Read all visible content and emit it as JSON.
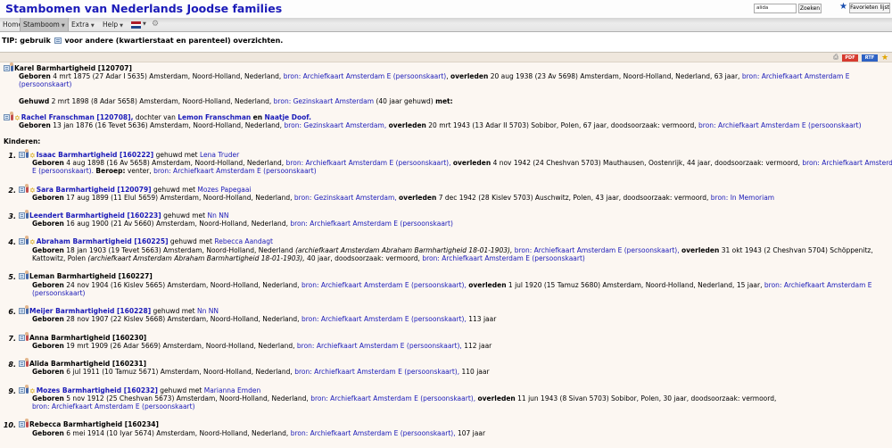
{
  "header": {
    "title": "Stambomen van Nederlands Joodse families",
    "search_value": "alida barmhartig",
    "search_button": "Zoeken",
    "favorites_button": "Favorieten lijst"
  },
  "menu": {
    "home": "Home",
    "stamboom": "Stamboom",
    "extra": "Extra",
    "help": "Help"
  },
  "tip": {
    "prefix": "TIP: gebruik",
    "suffix": "voor andere (kwartierstaat en parenteel) overzichten."
  },
  "toolbar": {
    "pdf": "PDF",
    "rtf": "RTF"
  },
  "labels": {
    "geboren": "Geboren",
    "overleden": "overleden",
    "gehuwd": "Gehuwd",
    "met": "met:",
    "gehuwd_met": "gehuwd met",
    "kinderen": "Kinderen:",
    "beroep": "Beroep:",
    "dochter_van": "dochter van",
    "en": "en"
  },
  "person": {
    "name": "Karel Barmhartigheid [120707]",
    "born": "4 mrt 1875 (27 Adar I 5635) Amsterdam, Noord-Holland, Nederland,",
    "born_source": "bron: Archiefkaart Amsterdam E (persoonskaart)",
    "died": "20 aug 1938 (23 Av 5698) Amsterdam, Noord-Holland, Nederland, 63 jaar,",
    "died_source_a": "bron: Archiefkaart Amsterdam E",
    "died_source_b": "(persoonskaart)"
  },
  "marriage": {
    "date": "2 mrt 1898 (8 Adar 5658) Amsterdam, Noord-Holland, Nederland,",
    "source": "bron: Gezinskaart Amsterdam",
    "years": "(40 jaar gehuwd)"
  },
  "spouse": {
    "name": "Rachel Franschman [120708],",
    "father": "Lemon Franschman",
    "mother": "Naatje Doof.",
    "born": "13 jan 1876 (16 Tevet 5636) Amsterdam, Noord-Holland, Nederland,",
    "born_source": "bron: Gezinskaart Amsterdam,",
    "died": "20 mrt 1943 (13 Adar II 5703) Sobibor, Polen, 67 jaar, doodsoorzaak: vermoord,",
    "died_source": "bron: Archiefkaart Amsterdam E (persoonskaart)"
  },
  "children": [
    {
      "num": "1.",
      "name": "Isaac Barmhartigheid [160222]",
      "spouse": "Lena Truder",
      "born": "4 aug 1898 (16 Av 5658) Amsterdam, Noord-Holland, Nederland,",
      "born_source": "bron: Archiefkaart Amsterdam E (persoonskaart),",
      "died": "4 nov 1942 (24 Cheshvan 5703) Mauthausen, Oostenrijk, 44 jaar, doodsoorzaak: vermoord,",
      "died_source_a": "bron: Archiefkaart Amsterdam",
      "died_source_b": "E (persoonskaart).",
      "occupation": "venter,",
      "occupation_source": "bron: Archiefkaart Amsterdam E (persoonskaart)"
    },
    {
      "num": "2.",
      "name": "Sara Barmhartigheid [120079]",
      "spouse": "Mozes Papegaai",
      "born": "17 aug 1899 (11 Elul 5659) Amsterdam, Noord-Holland, Nederland,",
      "born_source": "bron: Gezinskaart Amsterdam,",
      "died": "7 dec 1942 (28 Kislev 5703) Auschwitz, Polen, 43 jaar, doodsoorzaak: vermoord,",
      "died_source": "bron: In Memoriam"
    },
    {
      "num": "3.",
      "name": "Leendert Barmhartigheid [160223]",
      "spouse": "Nn NN",
      "born": "16 aug 1900 (21 Av 5660) Amsterdam, Noord-Holland, Nederland,",
      "born_source": "bron: Archiefkaart Amsterdam E (persoonskaart)"
    },
    {
      "num": "4.",
      "name": "Abraham Barmhartigheid [160225]",
      "spouse": "Rebecca Aandagt",
      "born": "18 jan 1903 (19 Tevet 5663) Amsterdam, Noord-Holland, Nederland",
      "born_note": "(archiefkaart Amsterdam Abraham Barmhartigheid 18-01-1903),",
      "born_source": "bron: Archiefkaart Amsterdam E (persoonskaart),",
      "died": "31 okt 1943 (2 Cheshvan 5704) Schöppenitz,",
      "died_place": "Kattowitz, Polen",
      "died_note": "(archiefkaart Amsterdam Abraham Barmhartigheid 18-01-1903),",
      "died_rest": "40 jaar, doodsoorzaak: vermoord,",
      "died_source": "bron: Archiefkaart Amsterdam E (persoonskaart)"
    },
    {
      "num": "5.",
      "name": "Leman Barmhartigheid [160227]",
      "born": "24 nov 1904 (16 Kislev 5665) Amsterdam, Noord-Holland, Nederland,",
      "born_source": "bron: Archiefkaart Amsterdam E (persoonskaart),",
      "died": "1 jul 1920 (15 Tamuz 5680) Amsterdam, Noord-Holland, Nederland, 15 jaar,",
      "died_source_a": "bron: Archiefkaart Amsterdam E",
      "died_source_b": "(persoonskaart)"
    },
    {
      "num": "6.",
      "name": "Meijer Barmhartigheid [160228]",
      "spouse": "Nn NN",
      "born": "28 nov 1907 (22 Kislev 5668) Amsterdam, Noord-Holland, Nederland,",
      "born_source": "bron: Archiefkaart Amsterdam E (persoonskaart),",
      "born_rest": "113 jaar"
    },
    {
      "num": "7.",
      "name": "Anna Barmhartigheid [160230]",
      "born": "19 mrt 1909 (26 Adar 5669) Amsterdam, Noord-Holland, Nederland,",
      "born_source": "bron: Archiefkaart Amsterdam E (persoonskaart),",
      "born_rest": "112 jaar"
    },
    {
      "num": "8.",
      "name": "Alida Barmhartigheid [160231]",
      "born": "6 jul 1911 (10 Tamuz 5671) Amsterdam, Noord-Holland, Nederland,",
      "born_source": "bron: Archiefkaart Amsterdam E (persoonskaart),",
      "born_rest": "110 jaar"
    },
    {
      "num": "9.",
      "name": "Mozes Barmhartigheid [160232]",
      "spouse": "Marianna Emden",
      "born": "5 nov 1912 (25 Cheshvan 5673) Amsterdam, Noord-Holland, Nederland,",
      "born_source": "bron: Archiefkaart Amsterdam E (persoonskaart),",
      "died": "11 jun 1943 (8 Sivan 5703) Sobibor, Polen, 30 jaar, doodsoorzaak: vermoord,",
      "died_source": "bron: Archiefkaart Amsterdam E (persoonskaart)"
    },
    {
      "num": "10.",
      "name": "Rebecca Barmhartigheid [160234]",
      "born": "6 mei 1914 (10 Iyar 5674) Amsterdam, Noord-Holland, Nederland,",
      "born_source": "bron: Archiefkaart Amsterdam E (persoonskaart),",
      "born_rest": "107 jaar"
    }
  ]
}
